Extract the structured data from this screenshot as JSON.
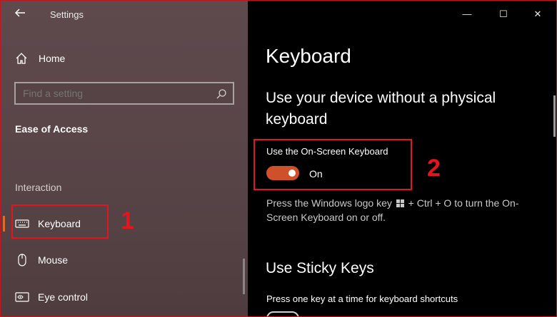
{
  "window": {
    "title": "Settings",
    "controls": {
      "minimize": "—",
      "maximize": "☐",
      "close": "✕"
    }
  },
  "sidebar": {
    "home_label": "Home",
    "search_placeholder": "Find a setting",
    "section_title": "Ease of Access",
    "group_label": "Interaction",
    "items": [
      {
        "label": "Keyboard",
        "icon": "keyboard-icon",
        "active": true
      },
      {
        "label": "Mouse",
        "icon": "mouse-icon",
        "active": false
      },
      {
        "label": "Eye control",
        "icon": "eye-control-icon",
        "active": false
      }
    ]
  },
  "main": {
    "page_title": "Keyboard",
    "subheading": "Use your device without a physical keyboard",
    "onscreen": {
      "label": "Use the On-Screen Keyboard",
      "state": "On",
      "desc_part1": "Press the Windows logo key",
      "desc_part2": "+ Ctrl + O to turn the On-Screen Keyboard on or off."
    },
    "sticky_title": "Use Sticky Keys",
    "sticky_label": "Press one key at a time for keyboard shortcuts"
  },
  "annotations": {
    "first": "1",
    "second": "2"
  },
  "colors": {
    "accent": "#d0502a",
    "callout": "#e3151d"
  }
}
